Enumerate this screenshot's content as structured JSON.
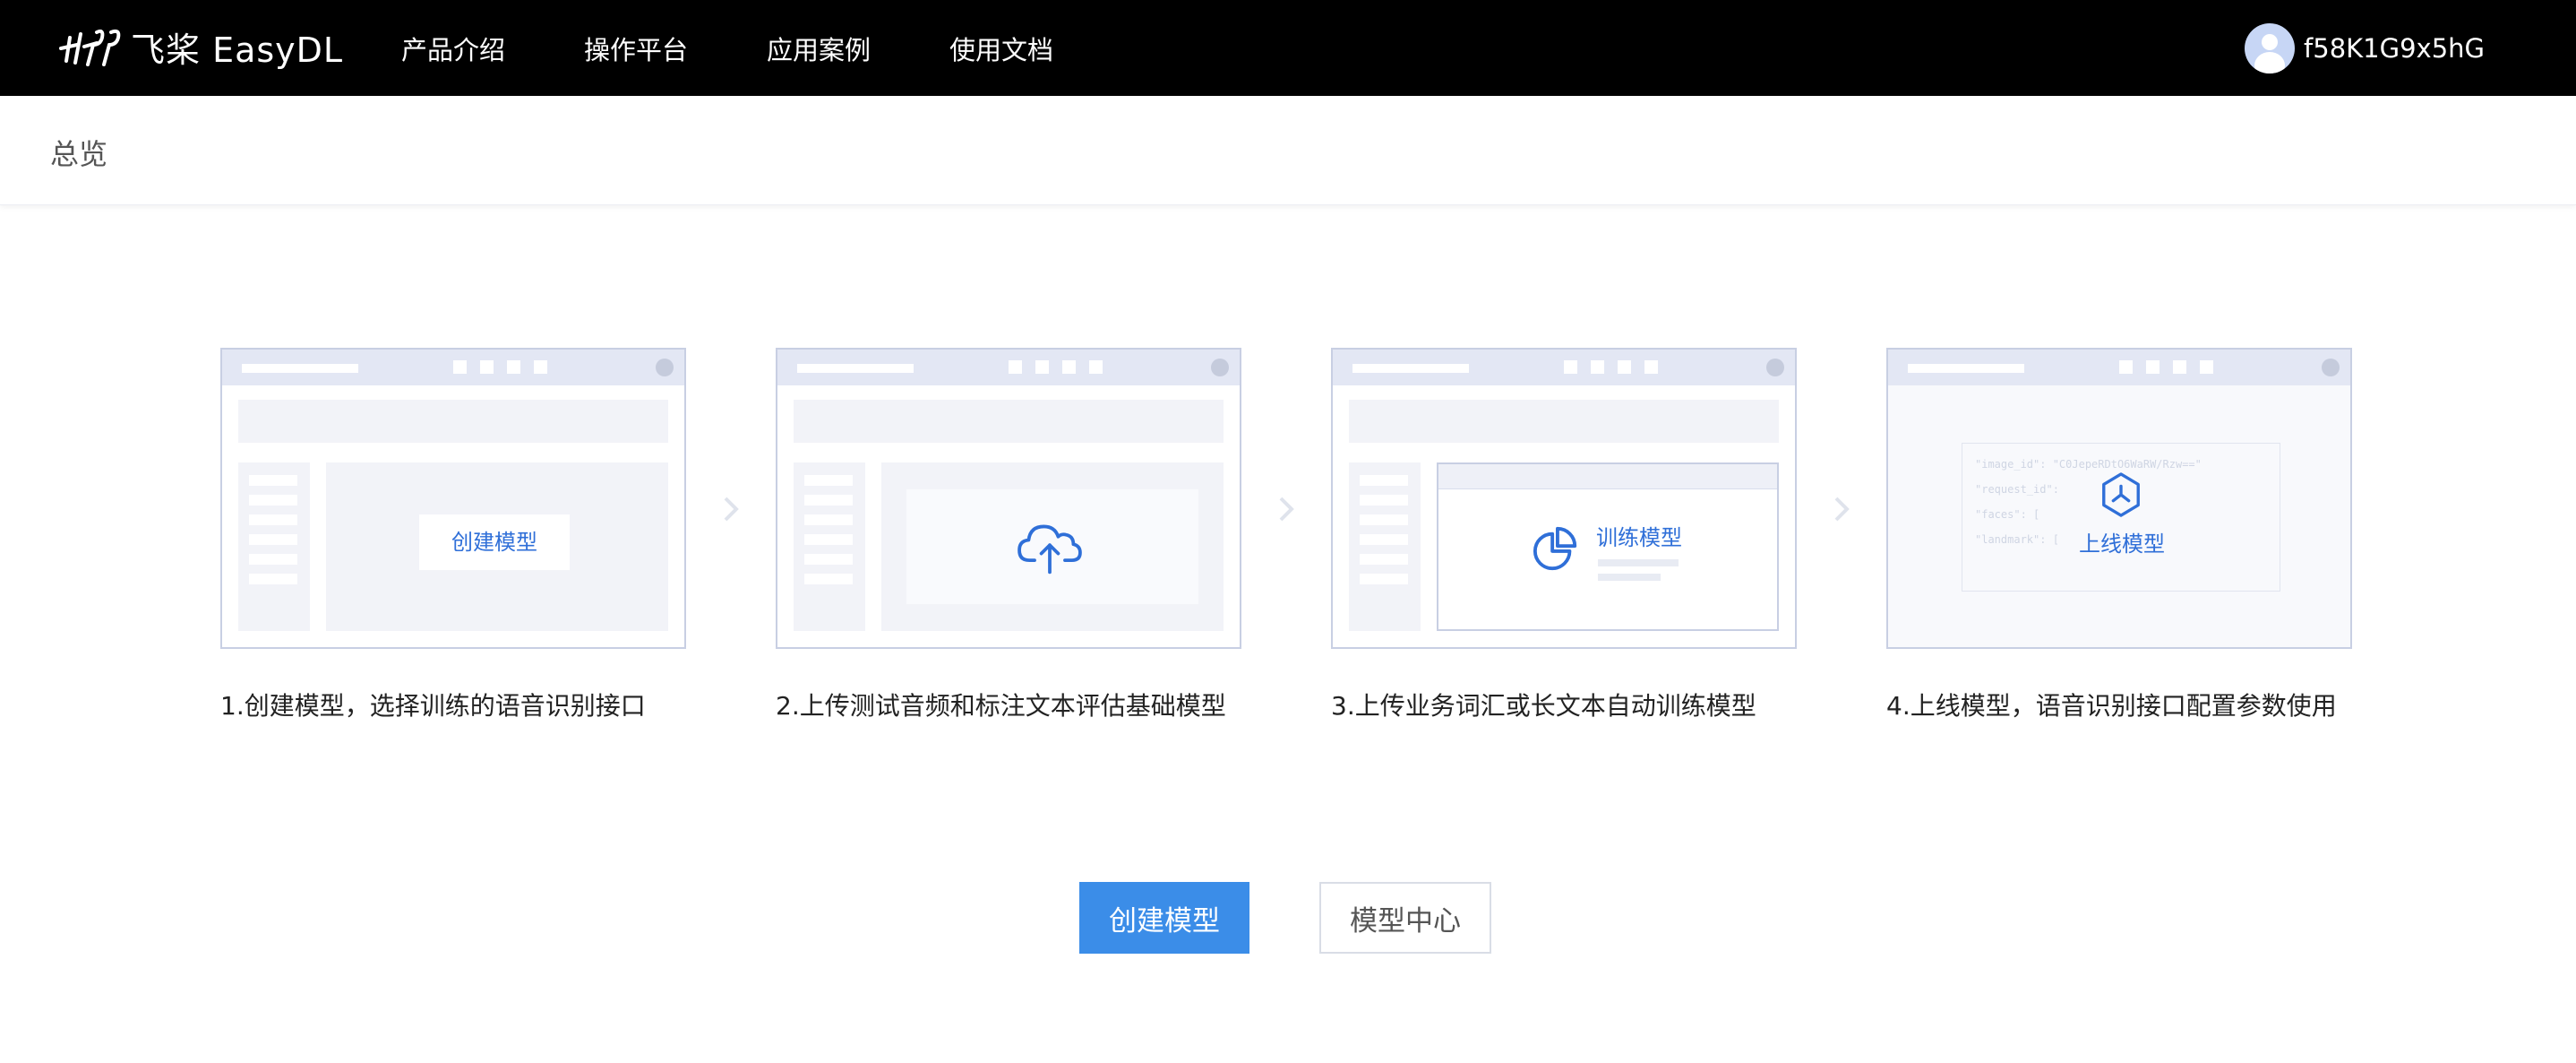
{
  "header": {
    "brand": "飞桨 EasyDL",
    "nav": [
      "产品介绍",
      "操作平台",
      "应用案例",
      "使用文档"
    ],
    "username": "f58K1G9x5hG"
  },
  "breadcrumb": "总览",
  "steps": [
    {
      "label": "1.创建模型，选择训练的语音识别接口",
      "inner": "创建模型"
    },
    {
      "label": "2.上传测试音频和标注文本评估基础模型"
    },
    {
      "label": "3.上传业务词汇或长文本自动训练模型",
      "inner": "训练模型"
    },
    {
      "label": "4.上线模型，语音识别接口配置参数使用",
      "inner": "上线模型",
      "code_lines": [
        "\"image_id\": \"C0JepeRDtO6WaRW/Rzw==\"",
        "\"request_id\":",
        "\"faces\": [",
        "\"landmark\": ["
      ]
    }
  ],
  "buttons": {
    "primary": "创建模型",
    "secondary": "模型中心"
  },
  "colors": {
    "accent": "#3b8de8",
    "topbar": "#000000",
    "link": "#2f6fd8"
  }
}
